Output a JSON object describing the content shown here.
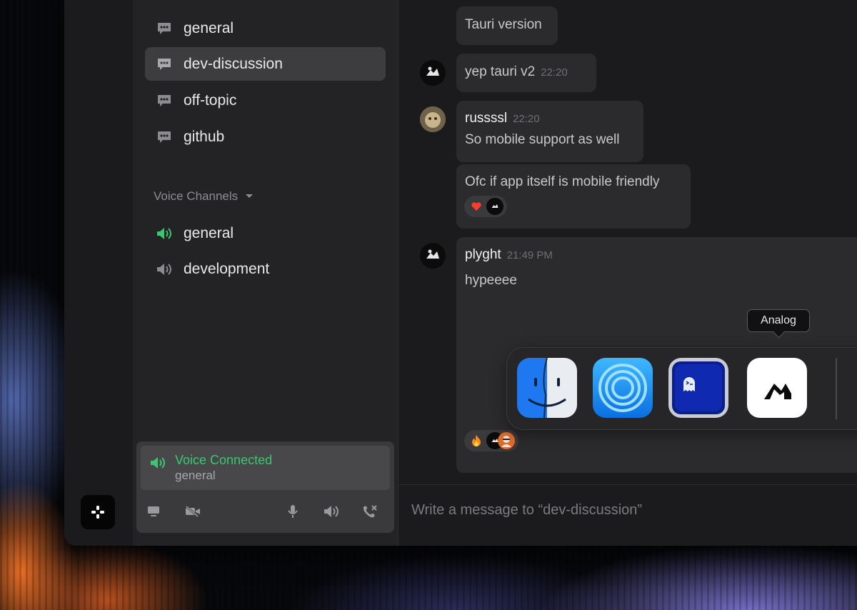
{
  "sidebar": {
    "text_channels": [
      {
        "label": "general",
        "active": false
      },
      {
        "label": "dev-discussion",
        "active": true
      },
      {
        "label": "off-topic",
        "active": false
      },
      {
        "label": "github",
        "active": false
      }
    ],
    "voice_section_title": "Voice Channels",
    "voice_channels": [
      {
        "label": "general",
        "connected": true
      },
      {
        "label": "development",
        "connected": false
      }
    ],
    "voice_panel": {
      "status": "Voice Connected",
      "channel": "general"
    }
  },
  "messages": [
    {
      "text": "Tauri version"
    },
    {
      "text": "yep tauri v2",
      "time": "22:20"
    },
    {
      "author": "russssl",
      "time": "22:20",
      "text": "So mobile support as well"
    },
    {
      "text": "Ofc if app itself is mobile friendly",
      "reactions": [
        "heart",
        "avatar"
      ]
    },
    {
      "author": "plyght",
      "time": "21:49 PM",
      "text": "hypeeee",
      "reactions": [
        "fire",
        "avatar",
        "avatar"
      ]
    }
  ],
  "dock": {
    "apps": [
      "Finder",
      "AirDrop",
      "Ghostty",
      "Analog"
    ],
    "tooltip": "Analog"
  },
  "composer": {
    "placeholder": "Write a message to “dev-discussion”"
  },
  "colors": {
    "accent_green": "#3cc66f",
    "panel_bg": "#232325",
    "message_bg": "#2b2b2e"
  }
}
